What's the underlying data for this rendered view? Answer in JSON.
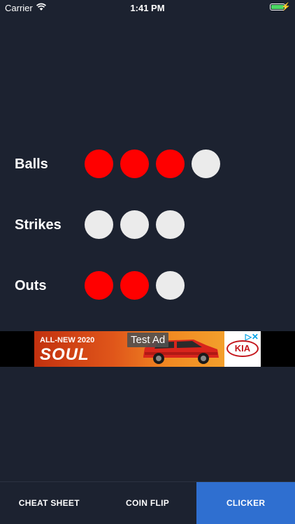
{
  "status_bar": {
    "carrier": "Carrier",
    "time": "1:41 PM",
    "battery_color": "#4cd964"
  },
  "counters": [
    {
      "label": "Balls",
      "total": 4,
      "filled": 3
    },
    {
      "label": "Strikes",
      "total": 3,
      "filled": 0
    },
    {
      "label": "Outs",
      "total": 3,
      "filled": 2
    }
  ],
  "colors": {
    "background": "#1c2230",
    "dot_on": "#ff0000",
    "dot_off": "#ebebeb",
    "active_tab": "#2f6fd0"
  },
  "ad": {
    "test_label": "Test Ad",
    "tagline": "ALL-NEW 2020",
    "model": "SOUL",
    "brand": "KIA",
    "choices_icon": "ad-choices-icon"
  },
  "tabs": [
    {
      "label": "CHEAT SHEET",
      "active": false
    },
    {
      "label": "COIN FLIP",
      "active": false
    },
    {
      "label": "CLICKER",
      "active": true
    }
  ]
}
